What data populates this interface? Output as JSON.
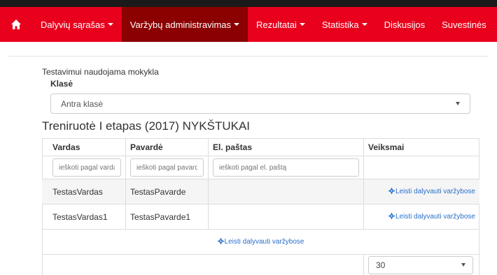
{
  "nav": {
    "items": [
      {
        "label": "Dalyvių sąrašas",
        "dropdown": true,
        "active": false
      },
      {
        "label": "Varžybų administravimas",
        "dropdown": true,
        "active": true
      },
      {
        "label": "Rezultatai",
        "dropdown": true,
        "active": false
      },
      {
        "label": "Statistika",
        "dropdown": true,
        "active": false
      },
      {
        "label": "Diskusijos",
        "dropdown": false,
        "active": false
      },
      {
        "label": "Suvestinės",
        "dropdown": false,
        "active": false
      }
    ],
    "home_icon": "home-icon"
  },
  "school": {
    "label": "Testavimui naudojama mokykla"
  },
  "class_select": {
    "label": "Klasė",
    "value": "Antra klasė"
  },
  "table": {
    "title": "Treniruotė I etapas (2017) NYKŠTUKAI",
    "columns": [
      "Vardas",
      "Pavardė",
      "El. paštas",
      "Veiksmai"
    ],
    "filters": [
      "ieškoti pagal vardą",
      "ieškoti pagal pavardę",
      "ieškoti pagal el. paštą"
    ],
    "rows": [
      {
        "vardas": "TestasVardas",
        "pavarde": "TestasPavarde",
        "email": "",
        "action": "Leisti dalyvauti varžybose"
      },
      {
        "vardas": "TestasVardas1",
        "pavarde": "TestasPavarde1",
        "email": "",
        "action": "Leisti dalyvauti varžybose"
      }
    ],
    "bulk_action": "Leisti dalyvauti varžybose",
    "page_size": "30"
  },
  "colors": {
    "nav_bg": "#e8001c",
    "nav_active": "#8b0000",
    "link": "#2a6fc9"
  }
}
